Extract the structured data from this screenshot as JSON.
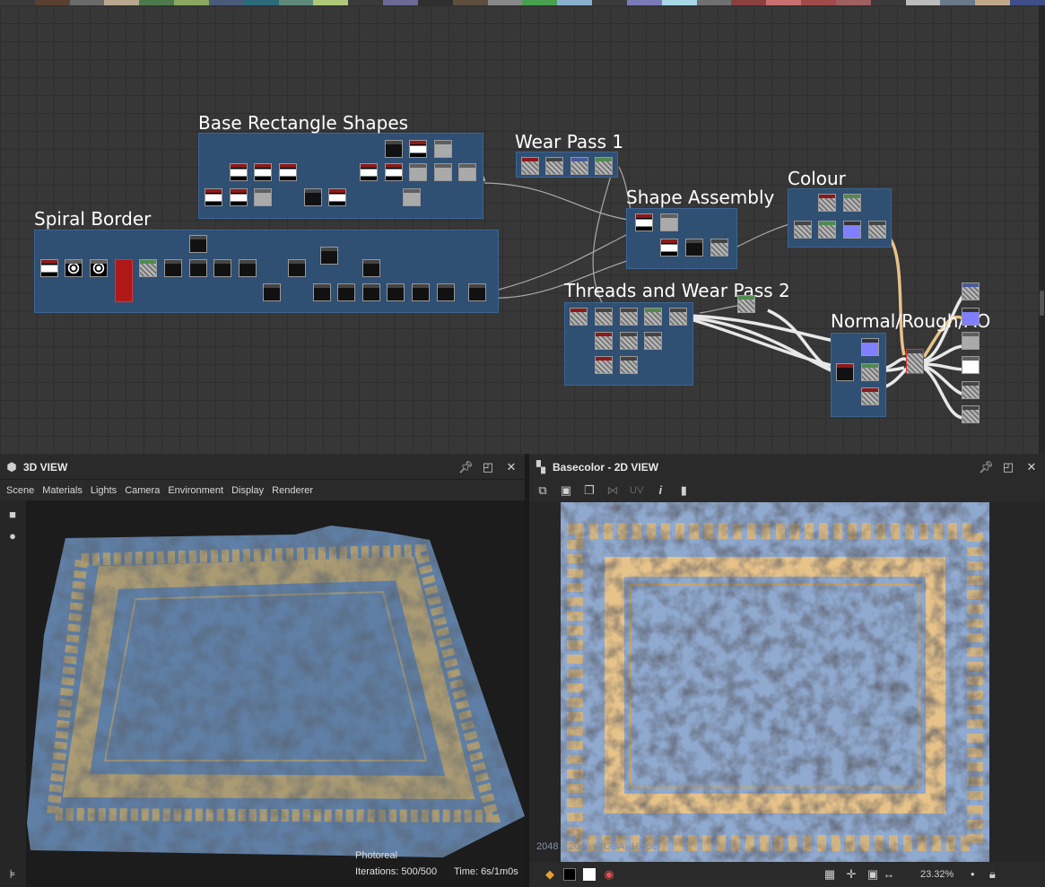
{
  "colors": {
    "frame": "#2f4f73",
    "accent_yellow": "#e7c38a",
    "rug_blue": "#8fa9cf",
    "swatches": [
      "#3b3b3b",
      "#5a4030",
      "#6a6a6a",
      "#b8a890",
      "#4c7a4c",
      "#8aa860",
      "#4a5a7a",
      "#2a6a7a",
      "#5f8a7a",
      "#aec878",
      "#3a3a3a",
      "#6d6a98",
      "#2f2f2f",
      "#5e4e3e",
      "#888888",
      "#46a050",
      "#8ab0d0",
      "#3b3b3b",
      "#7a7ab8",
      "#a8d8e8",
      "#707070",
      "#8b4040",
      "#c97070",
      "#a04a4a",
      "#a06060",
      "#3a3a3a",
      "#bcbcbc",
      "#6a7a8a",
      "#c2a88a",
      "#3f4e8a"
    ]
  },
  "graph": {
    "frames": [
      {
        "id": "base",
        "title": "Base Rectangle Shapes"
      },
      {
        "id": "wear1",
        "title": "Wear Pass 1"
      },
      {
        "id": "shape",
        "title": "Shape Assembly"
      },
      {
        "id": "colour",
        "title": "Colour"
      },
      {
        "id": "spiral",
        "title": "Spiral Border"
      },
      {
        "id": "threads",
        "title": "Threads and Wear Pass 2"
      },
      {
        "id": "normal",
        "title": "Normal/Rough/AO"
      }
    ]
  },
  "view3d": {
    "title": "3D VIEW",
    "menu": [
      "Scene",
      "Materials",
      "Lights",
      "Camera",
      "Environment",
      "Display",
      "Renderer"
    ],
    "tool_icons": [
      "camera-icon",
      "light-icon"
    ],
    "render_mode": "Photoreal",
    "iterations_label": "Iterations: 500/500",
    "time_label": "Time: 6s/1m0s"
  },
  "view2d": {
    "title": "Basecolor - 2D VIEW",
    "uv_label": "UV",
    "info_icon": "i",
    "resolution": "2048 x 2048 (RGBA, 16bpc)",
    "zoom": "23.32%"
  },
  "header_icons": [
    "pin-icon",
    "maximize-icon",
    "close-icon"
  ]
}
